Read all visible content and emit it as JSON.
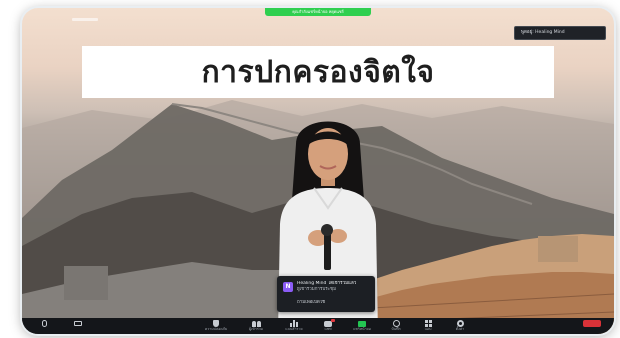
{
  "meeting": {
    "share_banner": "คุณกำลังแชร์หน้าจอ หยุดแชร์",
    "speaker_tag": "พูดอยู่: Healing Mind",
    "slide_title": "การปกครองจิตใจ"
  },
  "notification": {
    "icon_letter": "N",
    "title": "Healing Mind ได้เข้าร่วมแล้ว",
    "subtitle": "ผู้เข้าร่วมการประชุม",
    "action": "ถามเพื่อเปิดใช้"
  },
  "toolbar": {
    "items": [
      {
        "key": "mic",
        "label": "",
        "icon": "mic-icon"
      },
      {
        "key": "camera",
        "label": "",
        "icon": "camera-icon"
      },
      {
        "key": "security",
        "label": "ความปลอดภัย",
        "icon": "shield-icon"
      },
      {
        "key": "participants",
        "label": "ผู้เข้าร่วม",
        "icon": "people-icon"
      },
      {
        "key": "polls",
        "label": "แบบสำรวจ",
        "icon": "poll-icon"
      },
      {
        "key": "chat",
        "label": "แชท",
        "icon": "chat-icon"
      },
      {
        "key": "share",
        "label": "แชร์หน้าจอ",
        "icon": "share-screen-icon"
      },
      {
        "key": "record",
        "label": "บันทึก",
        "icon": "record-icon"
      },
      {
        "key": "apps",
        "label": "แอป",
        "icon": "apps-icon"
      },
      {
        "key": "settings",
        "label": "ตั้งค่า",
        "icon": "gear-icon"
      },
      {
        "key": "end",
        "label": "",
        "icon": "end-icon"
      }
    ]
  },
  "colors": {
    "share_banner": "#2fcf4f",
    "share_button": "#23c552",
    "end_button": "#d93238",
    "toolbar_bg": "#14161a",
    "notification_icon": "#8b5cf6"
  }
}
